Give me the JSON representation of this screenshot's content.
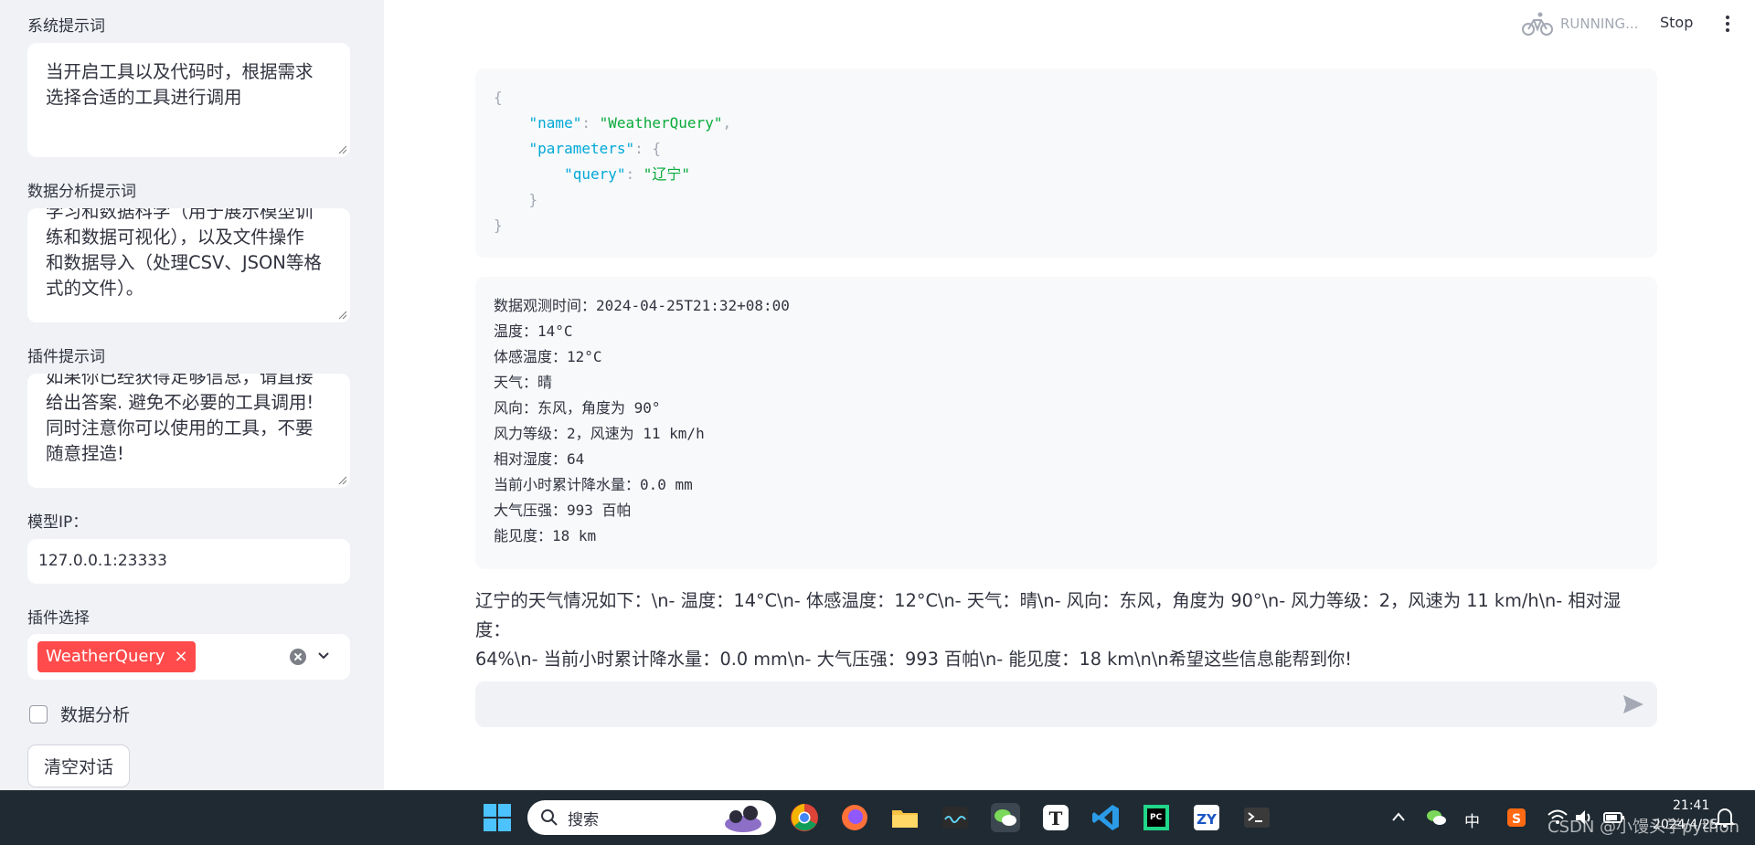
{
  "sidebar": {
    "system_prompt": {
      "label": "系统提示词",
      "value_line1": "当开启工具以及代码时，根据需求",
      "value_line2": "选择合适的工具进行调用"
    },
    "data_prompt": {
      "label": "数据分析提示词",
      "line1": "学习和数据科学（用于展示模型训",
      "line2": "练和数据可视化），以及文件操作",
      "line3": "和数据导入（处理CSV、JSON等格",
      "line4": "式的文件）。"
    },
    "plugin_prompt": {
      "label": "插件提示词",
      "line1": "如果你已经获得足够信息，请直接",
      "line2": "给出答案. 避免不必要的工具调用!",
      "line3": "同时注意你可以使用的工具，不要",
      "line4": "随意捏造!"
    },
    "model_ip": {
      "label": "模型IP：",
      "value": "127.0.0.1:23333"
    },
    "plugin_select": {
      "label": "插件选择",
      "tag": "WeatherQuery",
      "tag_remove": "×"
    },
    "data_analysis_checkbox": {
      "label": "数据分析",
      "checked": false
    },
    "clear_button": "清空对话"
  },
  "header": {
    "status": "RUNNING...",
    "stop": "Stop"
  },
  "main": {
    "tool_call": {
      "name_key": "\"name\"",
      "name_value": "\"WeatherQuery\"",
      "params_key": "\"parameters\"",
      "query_key": "\"query\"",
      "query_value": "\"辽宁\""
    },
    "weather_lines": [
      "数据观测时间：2024-04-25T21:32+08:00",
      "温度：14°C",
      "体感温度：12°C",
      "天气：晴",
      "风向：东风，角度为 90°",
      "风力等级：2，风速为 11 km/h",
      "相对湿度：64",
      "当前小时累计降水量：0.0 mm",
      "大气压强：993 百帕",
      "能见度：18 km"
    ],
    "answer_line1": "辽宁的天气情况如下：\\n- 温度：14°C\\n- 体感温度：12°C\\n- 天气：晴\\n- 风向：东风，角度为 90°\\n- 风力等级：2，风速为 11 km/h\\n- 相对湿度：",
    "answer_line2": "64%\\n- 当前小时累计降水量：0.0 mm\\n- 大气压强：993 百帕\\n- 能见度：18 km\\n\\n希望这些信息能帮到你!"
  },
  "taskbar": {
    "search_placeholder": "搜索",
    "ime": "中",
    "time": "21:41",
    "date": "2024/4/25",
    "watermark": "CSDN @小馒头学python"
  },
  "colors": {
    "accent": "#ff4b4b",
    "sidebar_bg": "#f0f2f6",
    "code_bg": "#f8f9fb",
    "taskbar_bg": "#1f2a33"
  }
}
